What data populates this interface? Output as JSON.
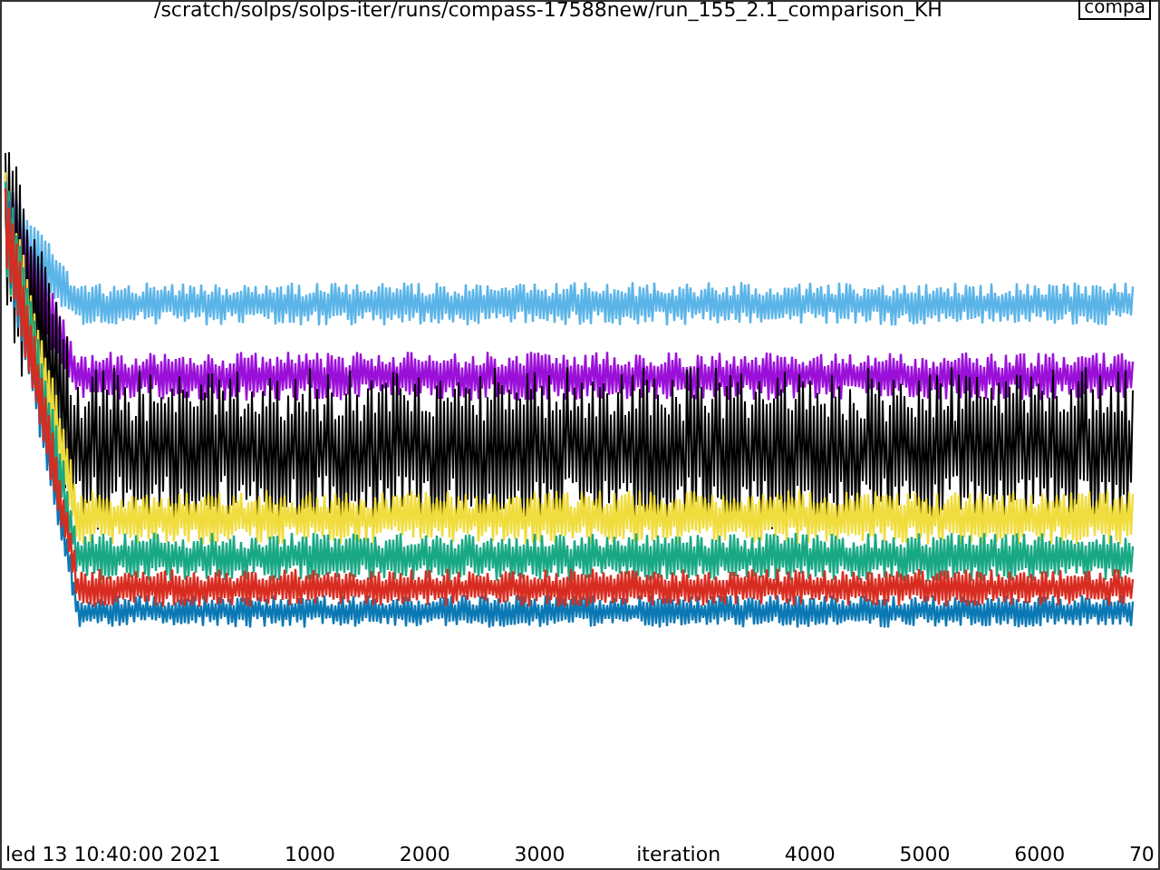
{
  "title": "/scratch/solps/solps-iter/runs/compass-17588new/run_155_2.1_comparison_KH",
  "legend": "compa",
  "footer": "led 13 10:40:00 2021",
  "x_axis": {
    "label": "iteration",
    "ticks": [
      "1000",
      "2000",
      "3000",
      "4000",
      "5000",
      "6000",
      "70"
    ]
  }
}
